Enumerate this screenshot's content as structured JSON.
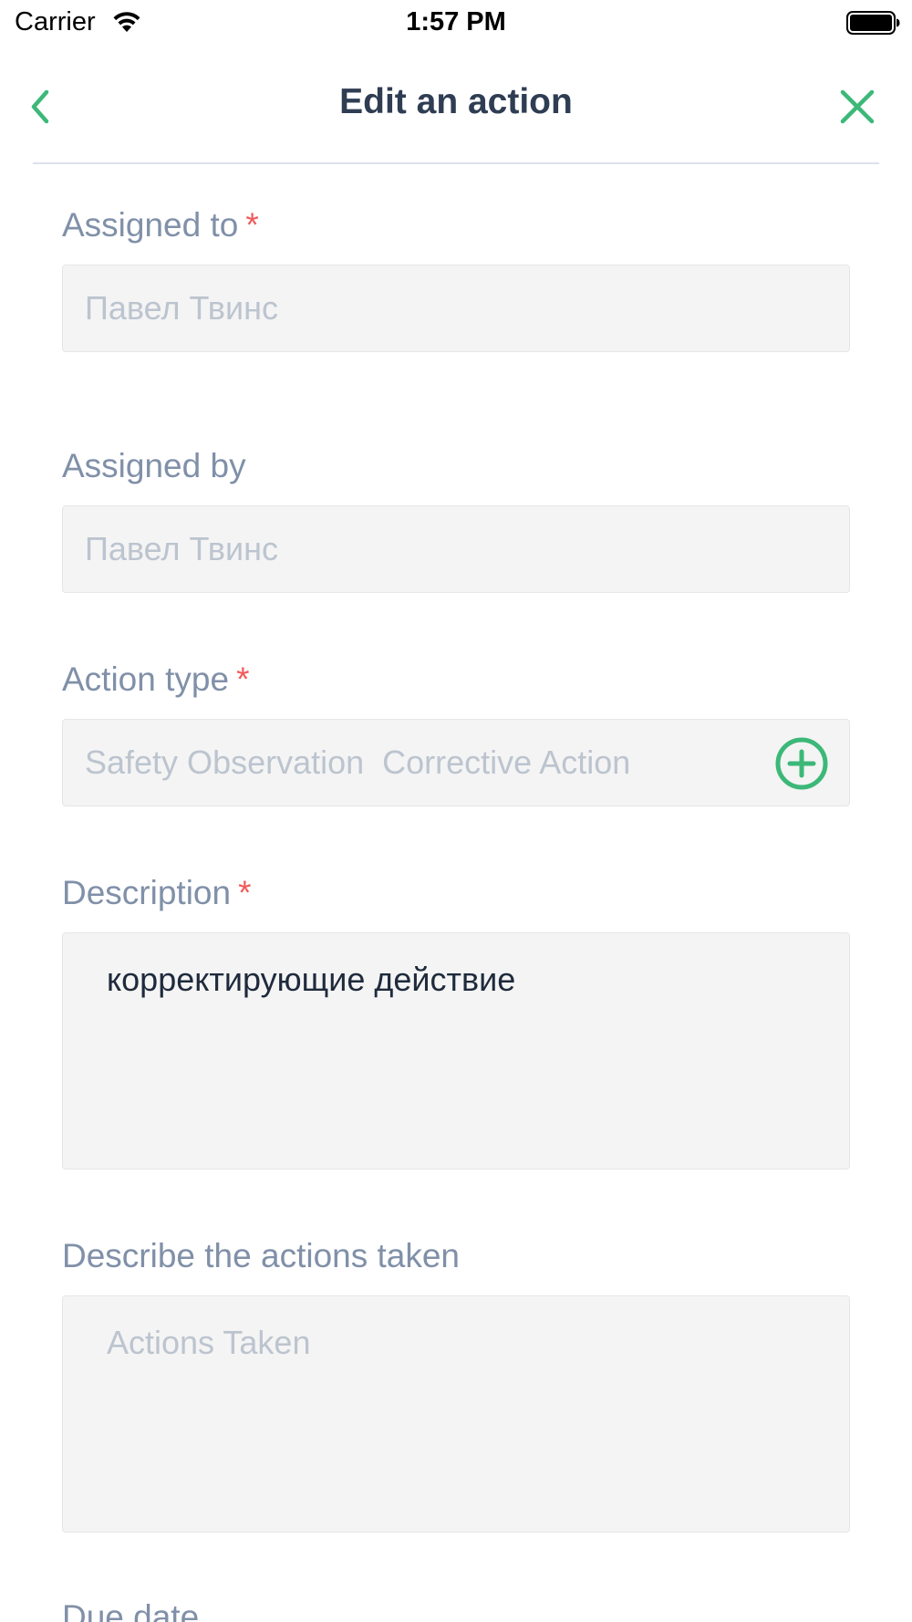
{
  "status_bar": {
    "carrier": "Carrier",
    "time": "1:57 PM"
  },
  "nav": {
    "title": "Edit an action"
  },
  "form": {
    "assigned_to": {
      "label": "Assigned to",
      "required_mark": "*",
      "value": "Павел Твинс"
    },
    "assigned_by": {
      "label": "Assigned by",
      "value": "Павел Твинс"
    },
    "action_type": {
      "label": "Action type",
      "required_mark": "*",
      "value": "Safety Observation  Corrective Action"
    },
    "description": {
      "label": "Description",
      "required_mark": "*",
      "value": "корректирующие действие"
    },
    "actions_taken": {
      "label": "Describe the actions taken",
      "placeholder": "Actions Taken"
    },
    "due_date": {
      "label": "Due date"
    }
  },
  "colors": {
    "accent": "#3cb878",
    "title": "#2f3d53",
    "label": "#8090a8",
    "required": "#f05a5a",
    "field_bg": "#f4f4f4"
  },
  "icons": {
    "back": "chevron-left-icon",
    "close": "close-icon",
    "add": "plus-circle-icon",
    "wifi": "wifi-icon",
    "battery": "battery-icon"
  }
}
